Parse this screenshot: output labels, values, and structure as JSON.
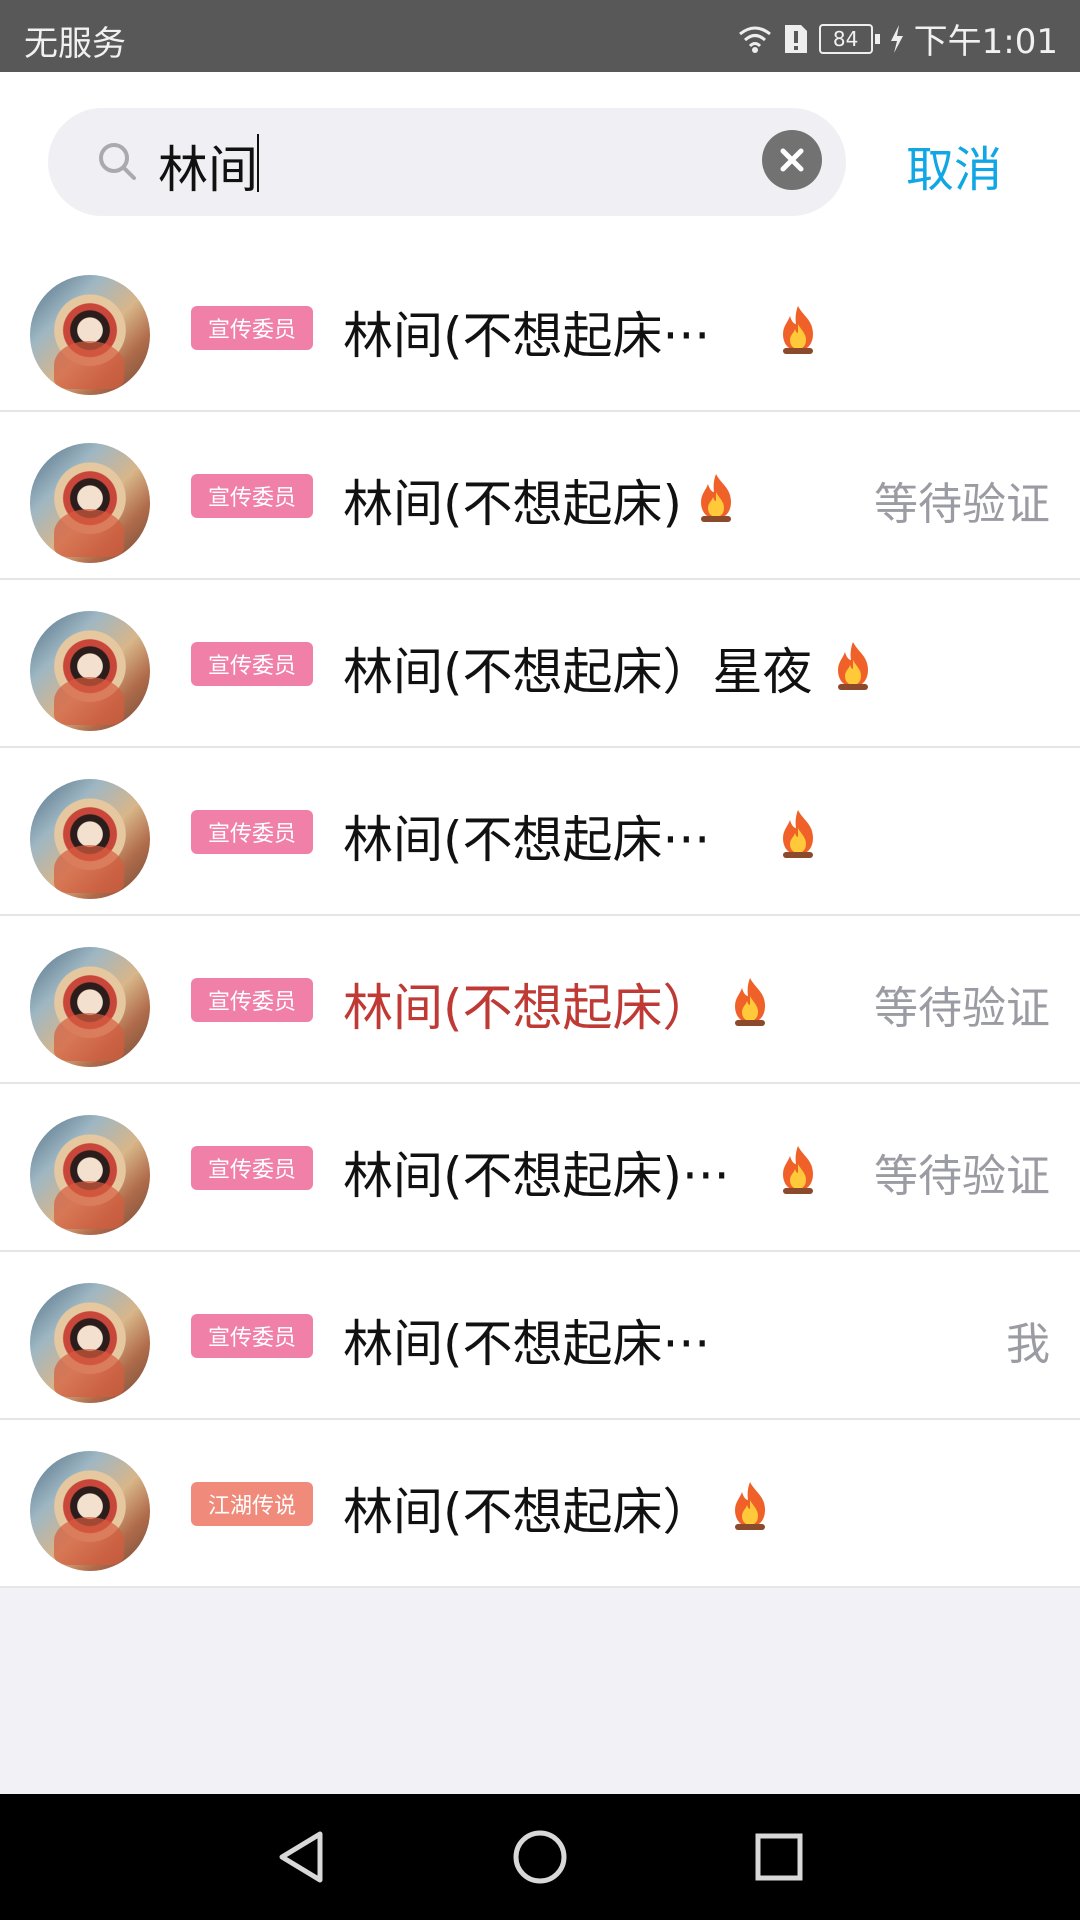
{
  "status_bar": {
    "carrier": "无服务",
    "battery": "84",
    "time": "下午1:01"
  },
  "search": {
    "query": "林间",
    "cancel_label": "取消"
  },
  "results": [
    {
      "badge": "宣传委员",
      "badge_color": "#f080a8",
      "name": "林间(不想起床···",
      "name_color": "#111111",
      "fire": true,
      "status": ""
    },
    {
      "badge": "宣传委员",
      "badge_color": "#f080a8",
      "name": "林间(不想起床)",
      "name_color": "#111111",
      "fire": true,
      "status": "等待验证"
    },
    {
      "badge": "宣传委员",
      "badge_color": "#f080a8",
      "name": "林间(不想起床）星夜",
      "name_color": "#111111",
      "fire": true,
      "status": ""
    },
    {
      "badge": "宣传委员",
      "badge_color": "#f080a8",
      "name": "林间(不想起床···",
      "name_color": "#111111",
      "fire": true,
      "status": ""
    },
    {
      "badge": "宣传委员",
      "badge_color": "#f080a8",
      "name": "林间(不想起床）",
      "name_color": "#bf3a35",
      "fire": true,
      "status": "等待验证"
    },
    {
      "badge": "宣传委员",
      "badge_color": "#f080a8",
      "name": "林间(不想起床)···",
      "name_color": "#111111",
      "fire": true,
      "status": "等待验证"
    },
    {
      "badge": "宣传委员",
      "badge_color": "#f080a8",
      "name": "林间(不想起床···",
      "name_color": "#111111",
      "fire": false,
      "status": "我"
    },
    {
      "badge": "江湖传说",
      "badge_color": "#f08a7a",
      "name": "林间(不想起床）",
      "name_color": "#111111",
      "fire": true,
      "status": ""
    }
  ],
  "colors": {
    "accent": "#10a7e4",
    "status_gray": "#9b9ba3"
  },
  "nav": {
    "back_icon": "back-triangle-icon",
    "home_icon": "home-circle-icon",
    "recents_icon": "recents-square-icon"
  }
}
